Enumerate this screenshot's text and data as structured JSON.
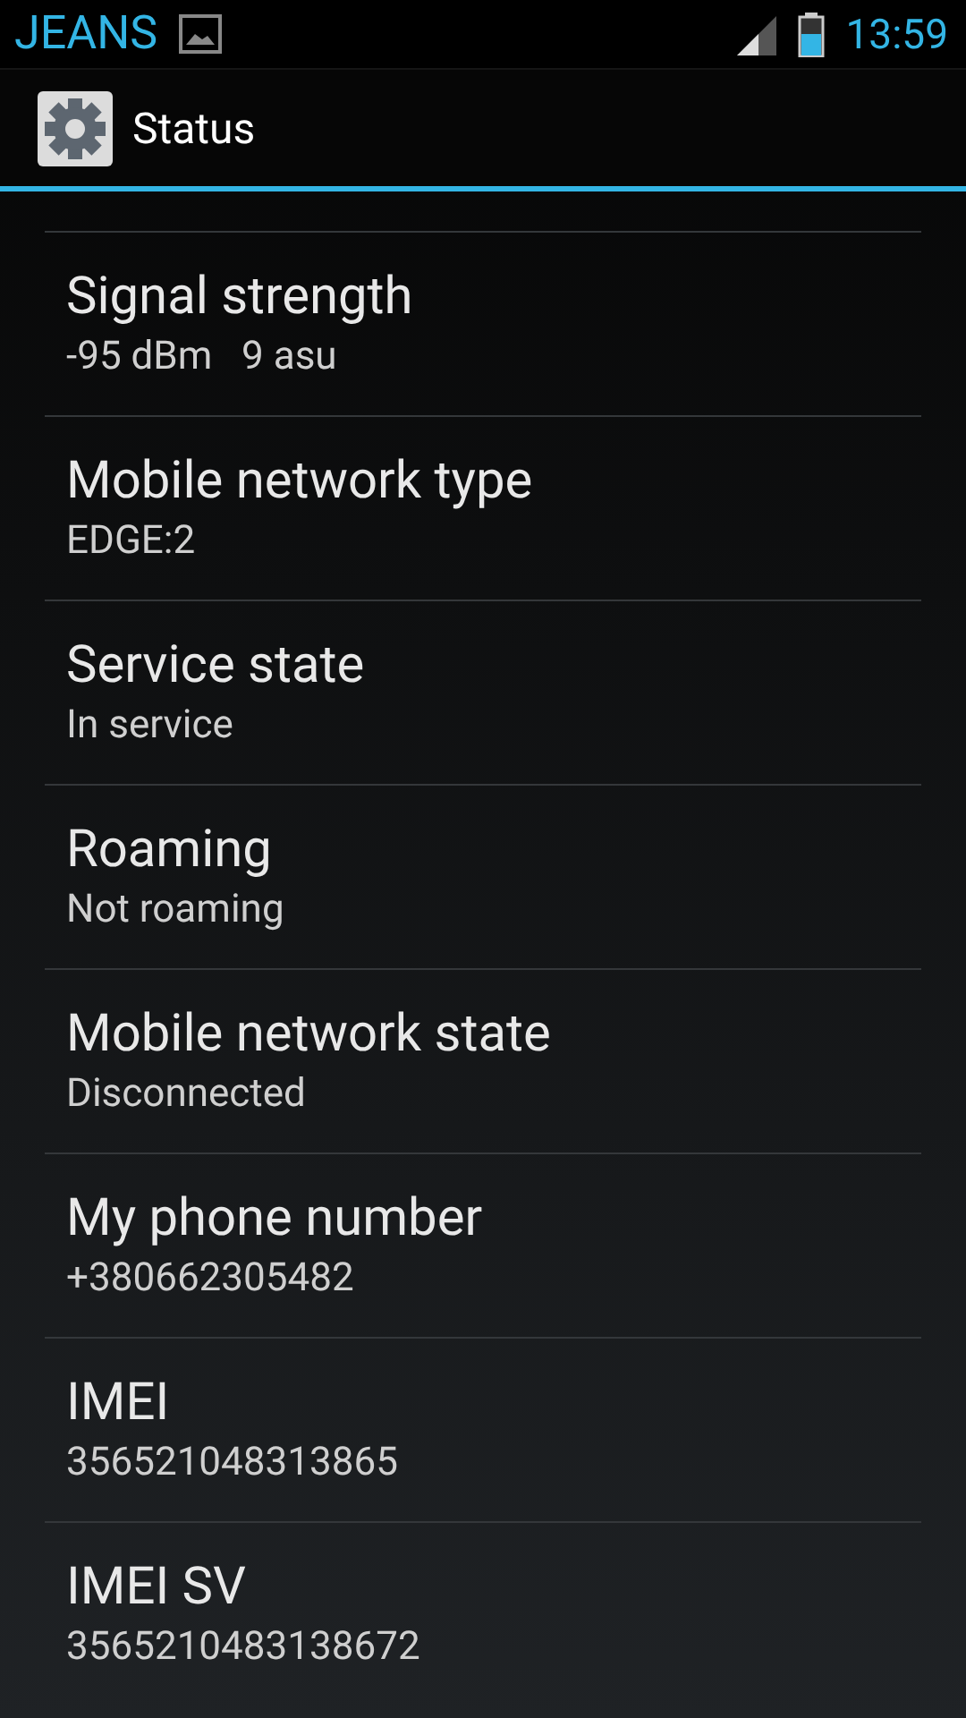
{
  "status_bar": {
    "carrier": "JEANS",
    "time": "13:59"
  },
  "action_bar": {
    "title": "Status"
  },
  "items": [
    {
      "title": "Signal strength",
      "summary": "-95 dBm   9 asu"
    },
    {
      "title": "Mobile network type",
      "summary": "EDGE:2"
    },
    {
      "title": "Service state",
      "summary": "In service"
    },
    {
      "title": "Roaming",
      "summary": "Not roaming"
    },
    {
      "title": "Mobile network state",
      "summary": "Disconnected"
    },
    {
      "title": "My phone number",
      "summary": "+380662305482"
    },
    {
      "title": "IMEI",
      "summary": "356521048313865"
    },
    {
      "title": "IMEI SV",
      "summary": "3565210483138672"
    }
  ]
}
